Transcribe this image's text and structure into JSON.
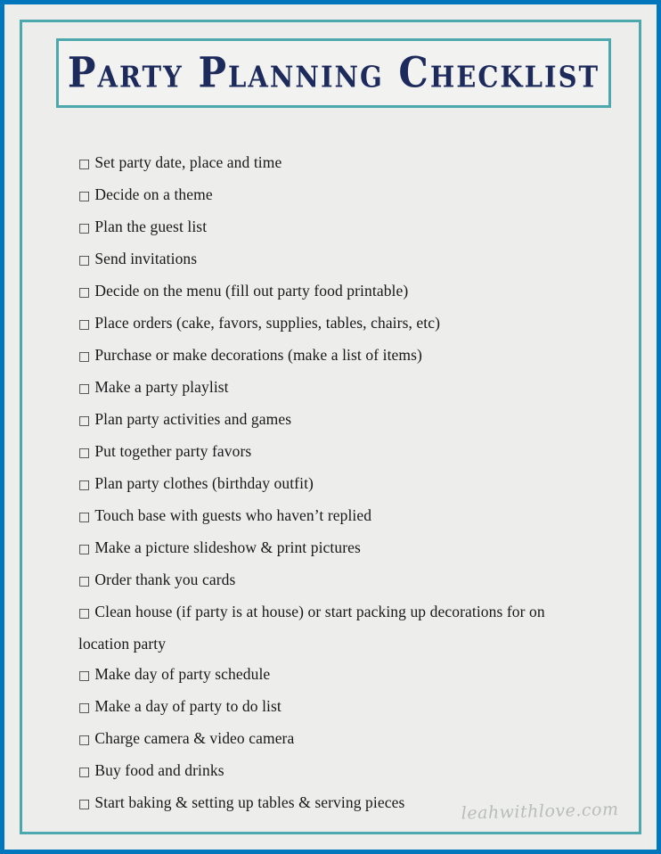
{
  "document": {
    "title": "Party Planning Checklist",
    "background_color": "#ededeb",
    "outer_frame_color": "#0077bc",
    "border_color": "#4da8ae",
    "title_color": "#1d2a5c",
    "text_color": "#18181a"
  },
  "checkbox_glyph": "□",
  "checklist": {
    "items": [
      {
        "label": "Set party date, place and time"
      },
      {
        "label": "Decide on a theme"
      },
      {
        "label": "Plan the guest list"
      },
      {
        "label": "Send invitations"
      },
      {
        "label": "Decide on the menu (fill out party food printable)"
      },
      {
        "label": "Place orders (cake, favors, supplies, tables, chairs, etc)"
      },
      {
        "label": "Purchase or make decorations (make a list of items)"
      },
      {
        "label": "Make a party playlist"
      },
      {
        "label": "Plan party activities and games"
      },
      {
        "label": "Put together party favors"
      },
      {
        "label": "Plan party clothes (birthday outfit)"
      },
      {
        "label": "Touch base with guests who haven’t replied"
      },
      {
        "label": "Make a picture slideshow & print pictures"
      },
      {
        "label": "Order thank you cards"
      },
      {
        "label": "Clean house (if party is at house) or start packing up decorations for on location party"
      },
      {
        "label": "Make day of party schedule"
      },
      {
        "label": "Make a day of party to do list"
      },
      {
        "label": "Charge camera & video camera"
      },
      {
        "label": "Buy food and drinks"
      },
      {
        "label": "Start baking & setting up tables & serving pieces"
      }
    ]
  },
  "watermark": {
    "text": "leahwithlove.com"
  }
}
